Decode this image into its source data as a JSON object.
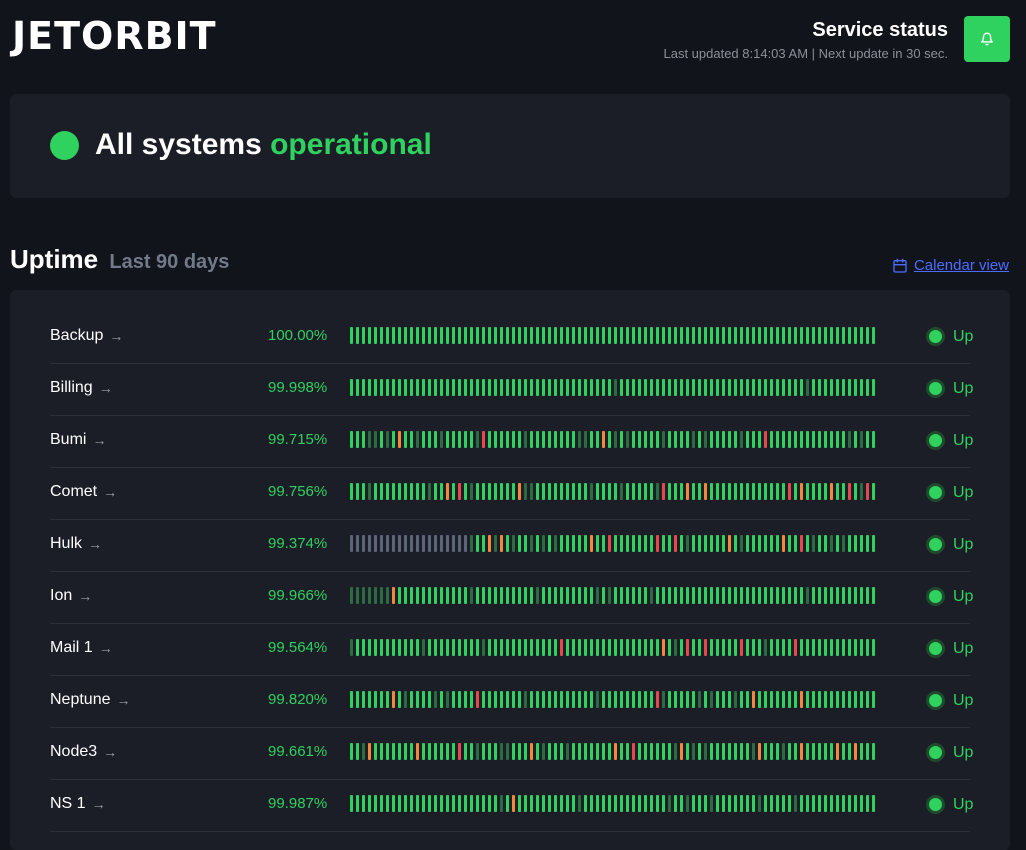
{
  "header": {
    "logo_text": "JETORBIT",
    "title": "Service status",
    "subtitle": "Last updated 8:14:03 AM | Next update in 30 sec."
  },
  "banner": {
    "text_prefix": "All systems",
    "text_status": "operational"
  },
  "uptime": {
    "title": "Uptime",
    "period": "Last 90 days",
    "calendar_link": "Calendar view"
  },
  "colors": {
    "up": "#2fd15f",
    "dim": "#2d6b42",
    "warn": "#f0883e",
    "down": "#e5484d",
    "nodata": "#5c6478"
  },
  "services": [
    {
      "name": "Backup",
      "percent": "100.00%",
      "status": "Up",
      "bars": ""
    },
    {
      "name": "Billing",
      "percent": "99.998%",
      "status": "Up",
      "bars": ""
    },
    {
      "name": "Bumi",
      "percent": "99.715%",
      "status": "Up",
      "bars": ""
    },
    {
      "name": "Comet",
      "percent": "99.756%",
      "status": "Up",
      "bars": ""
    },
    {
      "name": "Hulk",
      "percent": "99.374%",
      "status": "Up",
      "bars": ""
    },
    {
      "name": "Ion",
      "percent": "99.966%",
      "status": "Up",
      "bars": ""
    },
    {
      "name": "Mail 1",
      "percent": "99.564%",
      "status": "Up",
      "bars": ""
    },
    {
      "name": "Neptune",
      "percent": "99.820%",
      "status": "Up",
      "bars": ""
    },
    {
      "name": "Node3",
      "percent": "99.661%",
      "status": "Up",
      "bars": ""
    },
    {
      "name": "NS 1",
      "percent": "99.987%",
      "status": "Up",
      "bars": ""
    }
  ]
}
